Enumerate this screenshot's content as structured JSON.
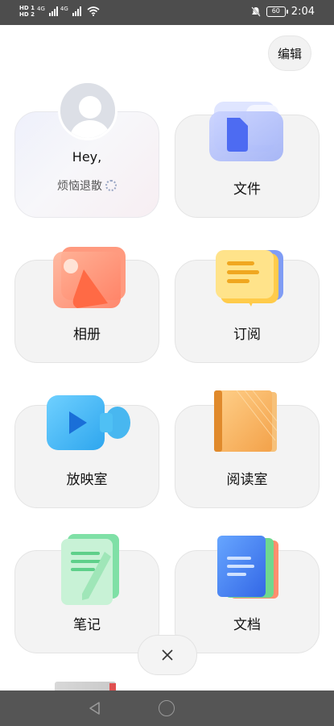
{
  "status_bar": {
    "sim1": "HD 1",
    "sim2": "HD 2",
    "net1": "4G",
    "net2": "4G",
    "battery": "60",
    "time": "2:04"
  },
  "header": {
    "edit_label": "编辑"
  },
  "profile": {
    "greeting": "Hey,",
    "nickname": "烦恼退散"
  },
  "cards": {
    "files": "文件",
    "album": "相册",
    "subscribe": "订阅",
    "theater": "放映室",
    "reading": "阅读室",
    "notes": "笔记",
    "docs": "文档"
  },
  "colors": {
    "accent_blue": "#5b7cf0",
    "album_orange": "#ff7a55",
    "subscribe_yellow": "#ffd54a",
    "theater_cyan": "#35b8f0",
    "reading_orange": "#f3a24a",
    "notes_green": "#5ed08a",
    "docs_blue": "#3f7ff0"
  }
}
